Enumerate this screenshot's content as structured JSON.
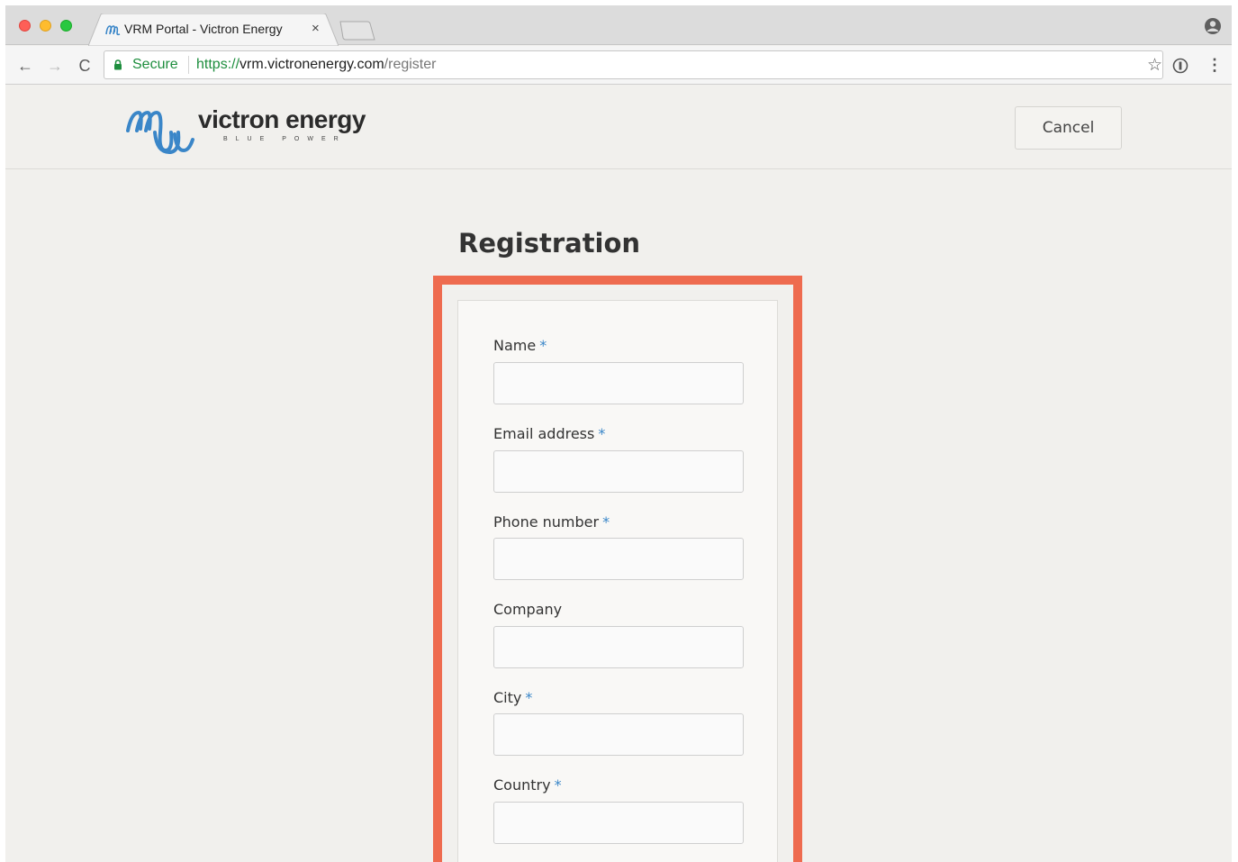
{
  "browser": {
    "tab_title": "VRM Portal - Victron Energy",
    "tab_close": "×",
    "secure_label": "Secure",
    "url_scheme": "https://",
    "url_host": "vrm.victronenergy.com",
    "url_path": "/register",
    "nav_back": "←",
    "nav_forward": "→",
    "nav_reload": "C",
    "star": "☆",
    "menu": "⋮"
  },
  "header": {
    "logo_text": "victron energy",
    "logo_tagline": "BLUE POWER",
    "cancel_label": "Cancel"
  },
  "page": {
    "title": "Registration"
  },
  "form": {
    "required_marker": "*",
    "fields": [
      {
        "label": "Name",
        "required": true,
        "value": ""
      },
      {
        "label": "Email address",
        "required": true,
        "value": ""
      },
      {
        "label": "Phone number",
        "required": true,
        "value": ""
      },
      {
        "label": "Company",
        "required": false,
        "value": ""
      },
      {
        "label": "City",
        "required": true,
        "value": ""
      },
      {
        "label": "Country",
        "required": true,
        "value": ""
      }
    ]
  },
  "colors": {
    "highlight": "#ee6b4f",
    "secure_green": "#1e8e3e",
    "required_blue": "#3a86c8",
    "brand_blue": "#3a86c8"
  }
}
